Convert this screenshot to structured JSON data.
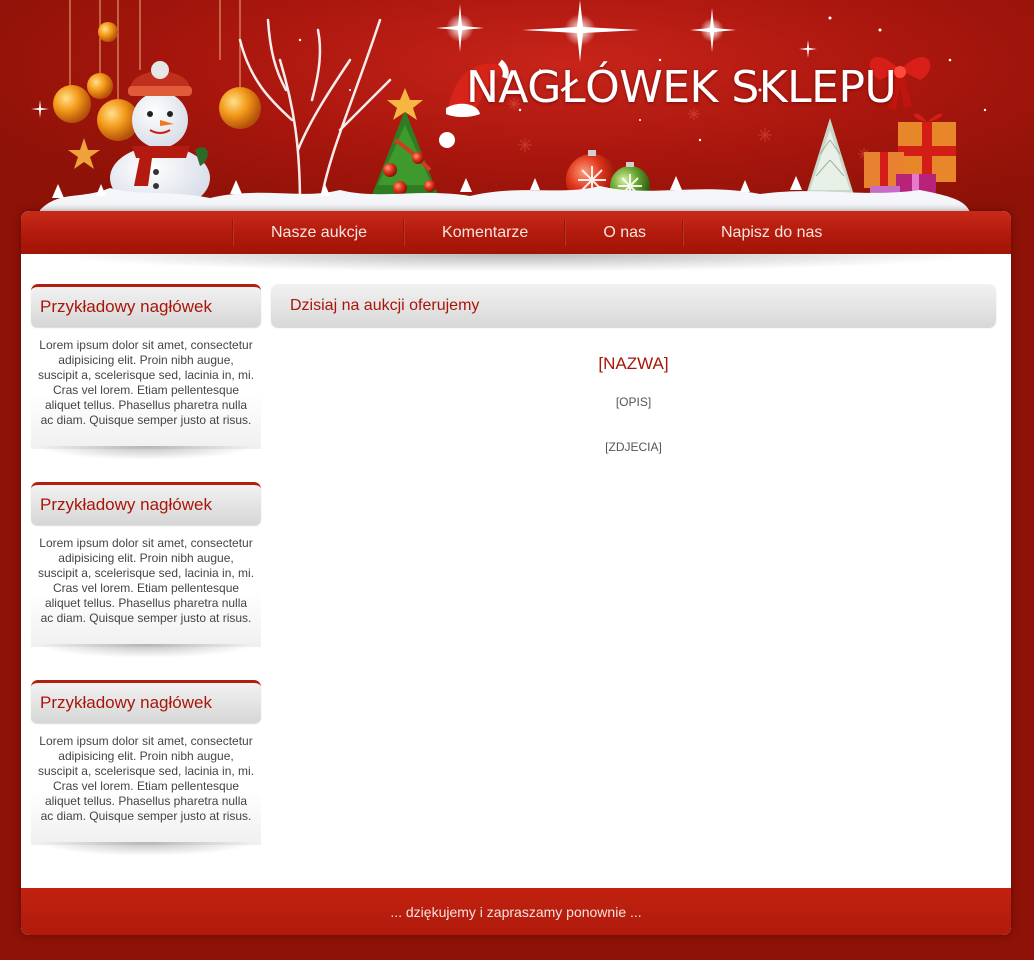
{
  "header": {
    "shop_title": "NAGŁÓWEK SKLEPU"
  },
  "nav": {
    "items": [
      {
        "label": "Nasze aukcje"
      },
      {
        "label": "Komentarze"
      },
      {
        "label": "O nas"
      },
      {
        "label": "Napisz do nas"
      }
    ]
  },
  "sidebar": {
    "widgets": [
      {
        "title": "Przykładowy nagłówek",
        "body": "Lorem ipsum dolor sit amet, consectetur adipisicing elit. Proin nibh augue, suscipit a, scelerisque sed, lacinia in, mi. Cras vel lorem. Etiam pellentesque aliquet tellus. Phasellus pharetra nulla ac diam. Quisque semper justo at risus."
      },
      {
        "title": "Przykładowy nagłówek",
        "body": "Lorem ipsum dolor sit amet, consectetur adipisicing elit. Proin nibh augue, suscipit a, scelerisque sed, lacinia in, mi. Cras vel lorem. Etiam pellentesque aliquet tellus. Phasellus pharetra nulla ac diam. Quisque semper justo at risus."
      },
      {
        "title": "Przykładowy nagłówek",
        "body": "Lorem ipsum dolor sit amet, consectetur adipisicing elit. Proin nibh augue, suscipit a, scelerisque sed, lacinia in, mi. Cras vel lorem. Etiam pellentesque aliquet tellus. Phasellus pharetra nulla ac diam. Quisque semper justo at risus."
      }
    ]
  },
  "main": {
    "heading": "Dzisiaj na aukcji oferujemy",
    "item_name": "[NAZWA]",
    "item_description": "[OPIS]",
    "item_photos": "[ZDJECIA]"
  },
  "footer": {
    "text": "... dziękujemy i zapraszamy ponownie ..."
  },
  "colors": {
    "background": "#8e1207",
    "nav_red": "#b11a0c",
    "accent_text": "#a8160a",
    "panel_grey": "#d8d8d8"
  }
}
